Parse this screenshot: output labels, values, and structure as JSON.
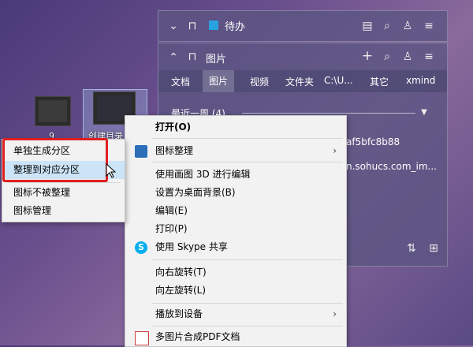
{
  "desktop": {
    "icon_labels": [
      "9",
      "创建目录"
    ]
  },
  "fence_todo": {
    "title": "待办"
  },
  "fence_images": {
    "title": "图片",
    "tabs": [
      "文档",
      "图片",
      "视频",
      "文件夹",
      "C:\\U...",
      "其它",
      "xmind"
    ],
    "active_tab": "图片",
    "group_label": "最近一周 (4)",
    "files": [
      "af5bfc8b88",
      "n.sohucs.com_im..."
    ]
  },
  "main_menu": {
    "items": [
      {
        "label": "打开(O)"
      },
      {
        "label": "图标整理",
        "has_submenu": true
      },
      {
        "label": "使用画图 3D 进行编辑"
      },
      {
        "label": "设置为桌面背景(B)"
      },
      {
        "label": "编辑(E)"
      },
      {
        "label": "打印(P)"
      },
      {
        "label": "使用 Skype 共享"
      },
      {
        "label": "向右旋转(T)"
      },
      {
        "label": "向左旋转(L)"
      },
      {
        "label": "播放到设备",
        "has_submenu": true
      },
      {
        "label": "多图片合成PDF文档"
      }
    ]
  },
  "sub_menu": {
    "items": [
      {
        "label": "单独生成分区"
      },
      {
        "label": "整理到对应分区"
      },
      {
        "label": "图标不被整理"
      },
      {
        "label": "图标管理"
      }
    ]
  },
  "colors": {
    "highlight": "#cce4f7",
    "annotation": "#e02020",
    "skype": "#00aff0"
  }
}
